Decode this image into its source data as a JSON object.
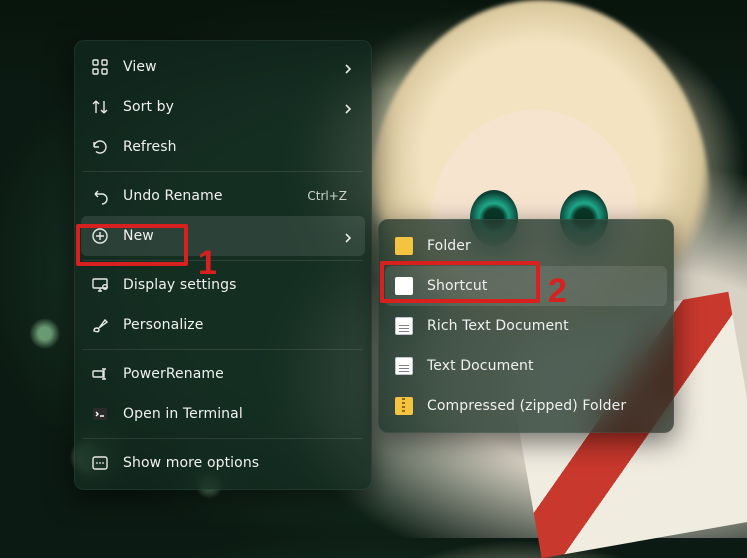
{
  "context_menu": {
    "items": [
      {
        "label": "View",
        "icon": "grid-icon",
        "hint": "",
        "chevron": true
      },
      {
        "label": "Sort by",
        "icon": "sort-icon",
        "hint": "",
        "chevron": true
      },
      {
        "label": "Refresh",
        "icon": "refresh-icon",
        "hint": "",
        "chevron": false
      },
      {
        "sep": true
      },
      {
        "label": "Undo Rename",
        "icon": "undo-icon",
        "hint": "Ctrl+Z",
        "chevron": false
      },
      {
        "label": "New",
        "icon": "plus-circle-icon",
        "hint": "",
        "chevron": true,
        "hover": true
      },
      {
        "sep": true
      },
      {
        "label": "Display settings",
        "icon": "display-icon",
        "hint": "",
        "chevron": false
      },
      {
        "label": "Personalize",
        "icon": "brush-icon",
        "hint": "",
        "chevron": false
      },
      {
        "sep": true
      },
      {
        "label": "PowerRename",
        "icon": "powerrename-icon",
        "hint": "",
        "chevron": false
      },
      {
        "label": "Open in Terminal",
        "icon": "terminal-icon",
        "hint": "",
        "chevron": false
      },
      {
        "sep": true
      },
      {
        "label": "Show more options",
        "icon": "more-icon",
        "hint": "",
        "chevron": false
      }
    ]
  },
  "new_submenu": {
    "items": [
      {
        "label": "Folder",
        "icon": "folder"
      },
      {
        "label": "Shortcut",
        "icon": "shortcut",
        "hover": true
      },
      {
        "label": "Rich Text Document",
        "icon": "doc"
      },
      {
        "label": "Text Document",
        "icon": "doc"
      },
      {
        "label": "Compressed (zipped) Folder",
        "icon": "zip"
      }
    ]
  },
  "annotations": {
    "step1": "1",
    "step2": "2",
    "highlight_color": "#d8201f"
  }
}
